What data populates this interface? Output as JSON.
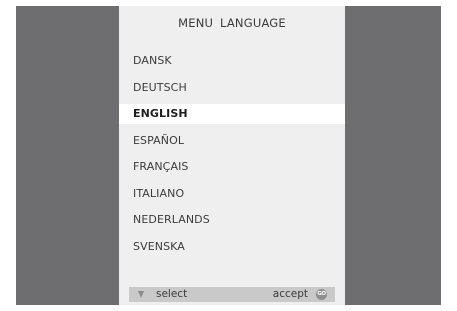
{
  "menu": {
    "title": "MENU  LANGUAGE",
    "items": [
      {
        "label": "DANSK"
      },
      {
        "label": "DEUTSCH"
      },
      {
        "label": "ENGLISH",
        "selected": true
      },
      {
        "label": "ESPAÑOL"
      },
      {
        "label": "FRANÇAIS"
      },
      {
        "label": "ITALIANO"
      },
      {
        "label": "NEDERLANDS"
      },
      {
        "label": "SVENSKA"
      }
    ]
  },
  "footer": {
    "arrow_icon": "down-arrow-icon",
    "select_label": "select",
    "accept_label": "accept",
    "go_label": "GO"
  },
  "colors": {
    "background": "#6e6e70",
    "panel": "#efefef",
    "highlight": "#ffffff",
    "footer_bar": "#c9c9c9"
  }
}
